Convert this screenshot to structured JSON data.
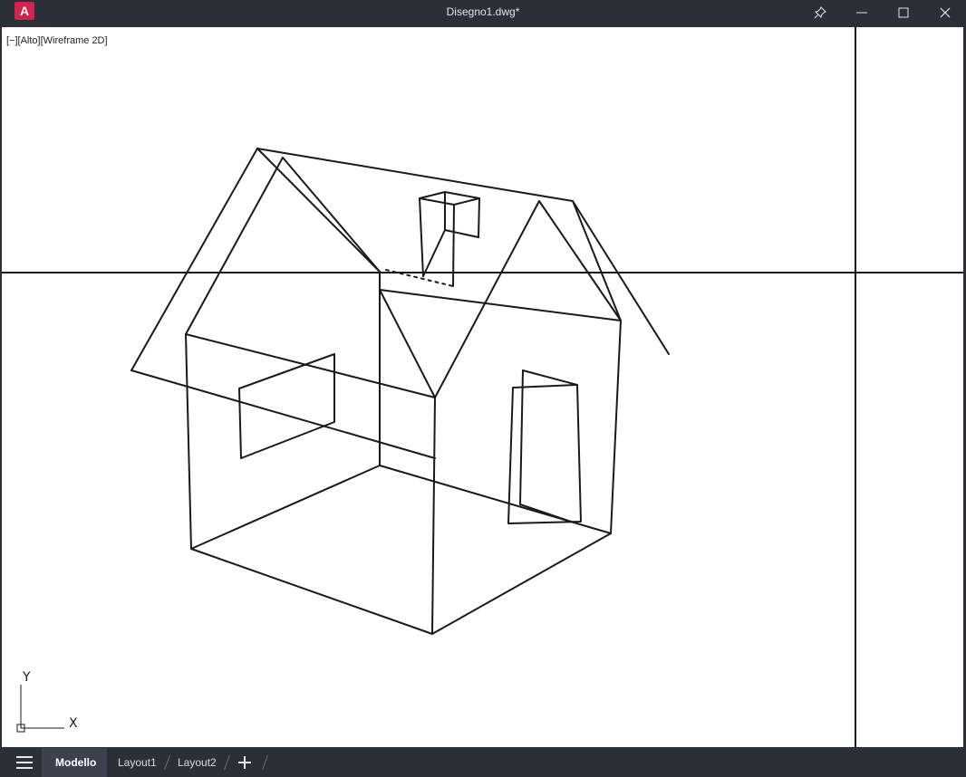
{
  "titlebar": {
    "logo_letter": "A",
    "document_title": "Disegno1.dwg*",
    "icons": [
      "pin-icon",
      "minimize-icon",
      "maximize-icon",
      "close-icon"
    ]
  },
  "viewport": {
    "view_label": "[−][Alto][Wireframe 2D]",
    "ucs": {
      "y_label": "Y",
      "x_label": "X"
    }
  },
  "statusbar": {
    "menu_icon": "hamburger-icon",
    "tabs": [
      {
        "label": "Modello",
        "active": true
      },
      {
        "label": "Layout1",
        "active": false
      },
      {
        "label": "Layout2",
        "active": false
      }
    ],
    "add_tab_icon": "plus-icon"
  },
  "colors": {
    "chrome": "#2b2f38",
    "logo": "#d3224e",
    "canvas": "#ffffff",
    "lines": "#1a1a1a"
  }
}
